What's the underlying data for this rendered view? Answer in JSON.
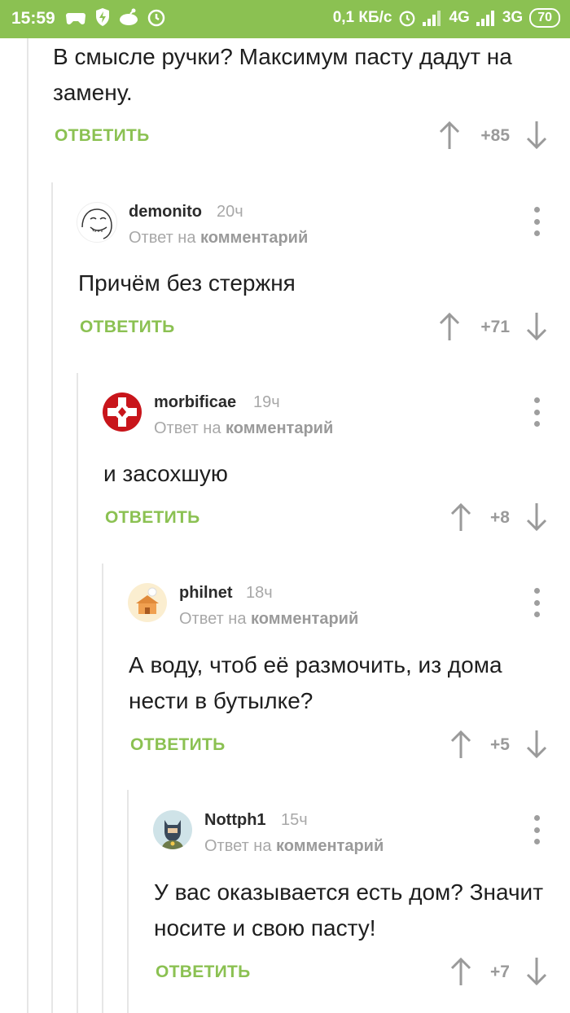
{
  "status_bar": {
    "time": "15:59",
    "net_speed": "0,1 КБ/с",
    "signal1": "4G",
    "signal2": "3G",
    "battery": "70"
  },
  "colors": {
    "accent": "#8bc152",
    "muted": "#a8a8a8",
    "text": "#1e1e1e"
  },
  "top_comment": {
    "text": "В смысле ручки? Максимум пасту дадут на замену.",
    "reply_label": "ОТВЕТИТЬ",
    "score": "+85"
  },
  "comments": [
    {
      "author": "demonito",
      "time": "20ч",
      "reply_prefix": "Ответ на",
      "reply_target": "комментарий",
      "text": "Причём без стержня",
      "reply_label": "ОТВЕТИТЬ",
      "score": "+71",
      "avatar_icon": "meme-face-avatar"
    },
    {
      "author": "morbificae",
      "time": "19ч",
      "reply_prefix": "Ответ на",
      "reply_target": "комментарий",
      "text": "и засохшую",
      "reply_label": "ОТВЕТИТЬ",
      "score": "+8",
      "avatar_icon": "red-cross-emblem-avatar"
    },
    {
      "author": "philnet",
      "time": "18ч",
      "reply_prefix": "Ответ на",
      "reply_target": "комментарий",
      "text": "А воду, чтоб её размочить, из дома нести в бутылке?",
      "reply_label": "ОТВЕТИТЬ",
      "score": "+5",
      "avatar_icon": "house-avatar"
    },
    {
      "author": "Nottph1",
      "time": "15ч",
      "reply_prefix": "Ответ на",
      "reply_target": "комментарий",
      "text": "У вас оказывается есть дом? Значит носите и свою пасту!",
      "reply_label": "ОТВЕТИТЬ",
      "score": "+7",
      "avatar_icon": "batman-avatar"
    }
  ]
}
